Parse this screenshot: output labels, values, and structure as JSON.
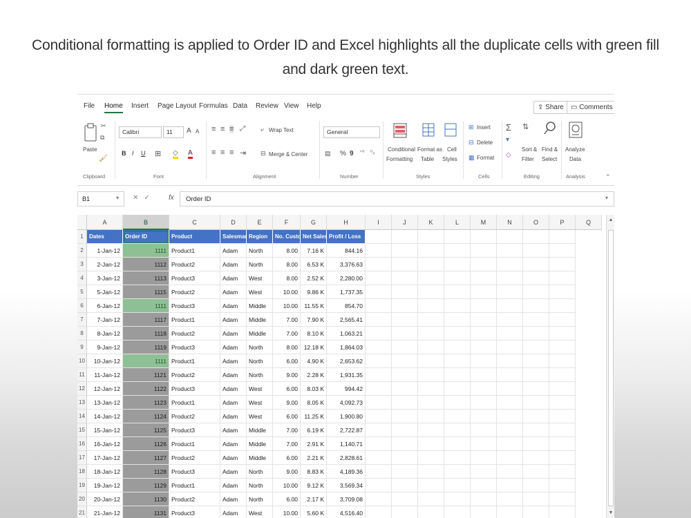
{
  "caption": "Conditional formatting is applied to Order ID and Excel highlights all the duplicate cells with green fill and dark green text.",
  "menu": {
    "tabs": [
      "File",
      "Home",
      "Insert",
      "Page Layout",
      "Formulas",
      "Data",
      "Review",
      "View",
      "Help"
    ],
    "active_tab": "Home",
    "share": "Share",
    "comments": "Comments"
  },
  "ribbon": {
    "clipboard": {
      "paste": "Paste",
      "label": "Clipboard"
    },
    "font": {
      "name": "Calibri",
      "size": "11",
      "grow": "A",
      "shrink": "A",
      "bold": "B",
      "italic": "I",
      "underline": "U",
      "label": "Font"
    },
    "alignment": {
      "wrap": "Wrap Text",
      "merge": "Merge & Center",
      "label": "Alignment"
    },
    "number": {
      "format": "General",
      "percent": "%",
      "comma": "9",
      "label": "Number"
    },
    "styles": {
      "conditional": "Conditional",
      "formatting": "Formatting",
      "format_as": "Format as",
      "table": "Table",
      "cell": "Cell",
      "styles_btn": "Styles",
      "label": "Styles"
    },
    "cells": {
      "insert": "Insert",
      "delete": "Delete",
      "format": "Format",
      "label": "Cells"
    },
    "editing": {
      "sort": "Sort &",
      "filter": "Filter",
      "find": "Find &",
      "select": "Select",
      "label": "Editing"
    },
    "analysis": {
      "analyze": "Analyze",
      "data": "Data",
      "label": "Analysis"
    }
  },
  "formula_bar": {
    "name_box": "B1",
    "fx": "fx",
    "content": "Order ID"
  },
  "columns": [
    "A",
    "B",
    "C",
    "D",
    "E",
    "F",
    "G",
    "H",
    "I",
    "J",
    "K",
    "L",
    "M",
    "N",
    "O",
    "P",
    "Q"
  ],
  "selected_column": "B",
  "headers": [
    "Dates",
    "Order ID",
    "Product",
    "Salesman",
    "Region",
    "No. Custo",
    "Net Sales",
    "Profit / Loss"
  ],
  "rows": [
    {
      "n": "2",
      "date": "1-Jan-12",
      "id": "1111",
      "product": "Product1",
      "salesman": "Adam",
      "region": "North",
      "cust": "8.00",
      "net": "7.16 K",
      "profit": "844.16",
      "dup": true
    },
    {
      "n": "3",
      "date": "2-Jan-12",
      "id": "1112",
      "product": "Product2",
      "salesman": "Adam",
      "region": "North",
      "cust": "8.00",
      "net": "6.53 K",
      "profit": "3,376.63",
      "dup": false
    },
    {
      "n": "4",
      "date": "3-Jan-12",
      "id": "1113",
      "product": "Product3",
      "salesman": "Adam",
      "region": "West",
      "cust": "8.00",
      "net": "2.52 K",
      "profit": "2,280.00",
      "dup": false
    },
    {
      "n": "5",
      "date": "5-Jan-12",
      "id": "1115",
      "product": "Product2",
      "salesman": "Adam",
      "region": "West",
      "cust": "10.00",
      "net": "9.86 K",
      "profit": "1,737.35",
      "dup": false
    },
    {
      "n": "6",
      "date": "6-Jan-12",
      "id": "1111",
      "product": "Product3",
      "salesman": "Adam",
      "region": "Middle",
      "cust": "10.00",
      "net": "11.55 K",
      "profit": "854.70",
      "dup": true
    },
    {
      "n": "7",
      "date": "7-Jan-12",
      "id": "1117",
      "product": "Product1",
      "salesman": "Adam",
      "region": "Middle",
      "cust": "7.00",
      "net": "7.90 K",
      "profit": "2,565.41",
      "dup": false
    },
    {
      "n": "8",
      "date": "8-Jan-12",
      "id": "1118",
      "product": "Product2",
      "salesman": "Adam",
      "region": "Middle",
      "cust": "7.00",
      "net": "8.10 K",
      "profit": "1,063.21",
      "dup": false
    },
    {
      "n": "9",
      "date": "9-Jan-12",
      "id": "1119",
      "product": "Product3",
      "salesman": "Adam",
      "region": "North",
      "cust": "8.00",
      "net": "12.18 K",
      "profit": "1,864.03",
      "dup": false
    },
    {
      "n": "10",
      "date": "10-Jan-12",
      "id": "1111",
      "product": "Product1",
      "salesman": "Adam",
      "region": "North",
      "cust": "6.00",
      "net": "4.90 K",
      "profit": "2,653.62",
      "dup": true
    },
    {
      "n": "11",
      "date": "11-Jan-12",
      "id": "1121",
      "product": "Product2",
      "salesman": "Adam",
      "region": "North",
      "cust": "9.00",
      "net": "2.28 K",
      "profit": "1,931.35",
      "dup": false
    },
    {
      "n": "12",
      "date": "12-Jan-12",
      "id": "1122",
      "product": "Product3",
      "salesman": "Adam",
      "region": "West",
      "cust": "6.00",
      "net": "8.03 K",
      "profit": "994.42",
      "dup": false
    },
    {
      "n": "13",
      "date": "13-Jan-12",
      "id": "1123",
      "product": "Product1",
      "salesman": "Adam",
      "region": "West",
      "cust": "9.00",
      "net": "8.05 K",
      "profit": "4,092.73",
      "dup": false
    },
    {
      "n": "14",
      "date": "14-Jan-12",
      "id": "1124",
      "product": "Product2",
      "salesman": "Adam",
      "region": "West",
      "cust": "6.00",
      "net": "11.25 K",
      "profit": "1,900.80",
      "dup": false
    },
    {
      "n": "15",
      "date": "15-Jan-12",
      "id": "1125",
      "product": "Product3",
      "salesman": "Adam",
      "region": "Middle",
      "cust": "7.00",
      "net": "6.19 K",
      "profit": "2,722.87",
      "dup": false
    },
    {
      "n": "16",
      "date": "16-Jan-12",
      "id": "1126",
      "product": "Product1",
      "salesman": "Adam",
      "region": "Middle",
      "cust": "7.00",
      "net": "2.91 K",
      "profit": "1,140.71",
      "dup": false
    },
    {
      "n": "17",
      "date": "17-Jan-12",
      "id": "1127",
      "product": "Product2",
      "salesman": "Adam",
      "region": "Middle",
      "cust": "6.00",
      "net": "2.21 K",
      "profit": "2,828.61",
      "dup": false
    },
    {
      "n": "18",
      "date": "18-Jan-12",
      "id": "1128",
      "product": "Product3",
      "salesman": "Adam",
      "region": "North",
      "cust": "9.00",
      "net": "8.83 K",
      "profit": "4,189.36",
      "dup": false
    },
    {
      "n": "19",
      "date": "19-Jan-12",
      "id": "1129",
      "product": "Product1",
      "salesman": "Adam",
      "region": "North",
      "cust": "10.00",
      "net": "9.12 K",
      "profit": "3,569.34",
      "dup": false
    },
    {
      "n": "20",
      "date": "20-Jan-12",
      "id": "1130",
      "product": "Product2",
      "salesman": "Adam",
      "region": "North",
      "cust": "6.00",
      "net": "2.17 K",
      "profit": "3,709.08",
      "dup": false
    },
    {
      "n": "21",
      "date": "21-Jan-12",
      "id": "1131",
      "product": "Product3",
      "salesman": "Adam",
      "region": "West",
      "cust": "10.00",
      "net": "5.60 K",
      "profit": "4,516.40",
      "dup": false
    }
  ],
  "colors": {
    "header_fill": "#4472c4",
    "dup_fill": "#8fbf94",
    "dup_text": "#1d5a26",
    "excel_green": "#217346"
  }
}
